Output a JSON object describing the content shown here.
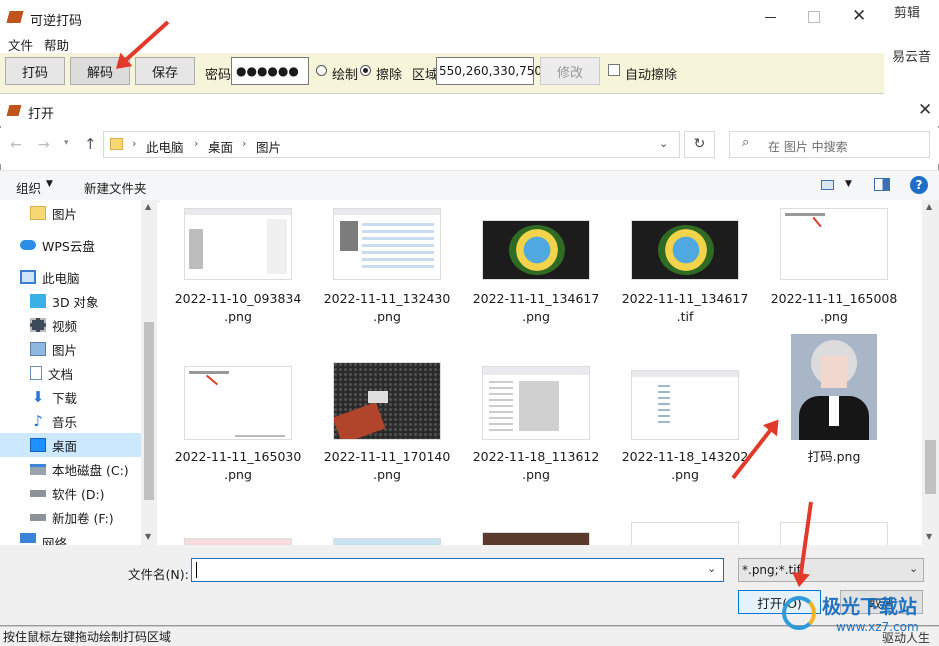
{
  "bg_app": {
    "title": "可逆打码",
    "menu": [
      "文件",
      "帮助"
    ],
    "buttons": {
      "mark": "打码",
      "decode": "解码",
      "save": "保存"
    },
    "password_label": "密码",
    "password_value": "●●●●●●",
    "draw_label": "绘制",
    "erase_label": "擦除",
    "region_label": "区域",
    "region_value": "550,260,330,750",
    "modify_label": "修改",
    "auto_erase_label": "自动擦除",
    "right_fragments": [
      "剪辑",
      "易云音",
      "驱动人生"
    ]
  },
  "dialog": {
    "title": "打开",
    "breadcrumb": [
      "此电脑",
      "桌面",
      "图片"
    ],
    "search_placeholder": "在 图片 中搜索",
    "organize_label": "组织",
    "new_folder_label": "新建文件夹",
    "nav_items": [
      {
        "label": "图片",
        "icon": "folder-icon"
      },
      {
        "label": "WPS云盘",
        "icon": "cloud-icon"
      },
      {
        "label": "此电脑",
        "icon": "computer-icon"
      },
      {
        "label": "3D 对象",
        "icon": "cube-icon"
      },
      {
        "label": "视频",
        "icon": "video-icon"
      },
      {
        "label": "图片",
        "icon": "picture-icon"
      },
      {
        "label": "文档",
        "icon": "document-icon"
      },
      {
        "label": "下载",
        "icon": "download-icon"
      },
      {
        "label": "音乐",
        "icon": "music-icon"
      },
      {
        "label": "桌面",
        "icon": "desktop-icon"
      },
      {
        "label": "本地磁盘 (C:)",
        "icon": "drive-icon"
      },
      {
        "label": "软件 (D:)",
        "icon": "drive-icon"
      },
      {
        "label": "新加卷 (F:)",
        "icon": "drive-icon"
      },
      {
        "label": "网络",
        "icon": "network-icon"
      }
    ],
    "files": [
      {
        "line1": "2022-11-10_093834",
        "line2": ".png"
      },
      {
        "line1": "2022-11-11_132430",
        "line2": ".png"
      },
      {
        "line1": "2022-11-11_134617",
        "line2": ".png"
      },
      {
        "line1": "2022-11-11_134617",
        "line2": ".tif"
      },
      {
        "line1": "2022-11-11_165008",
        "line2": ".png"
      },
      {
        "line1": "2022-11-11_165030",
        "line2": ".png"
      },
      {
        "line1": "2022-11-11_170140",
        "line2": ".png"
      },
      {
        "line1": "2022-11-18_113612",
        "line2": ".png"
      },
      {
        "line1": "2022-11-18_143202",
        "line2": ".png"
      },
      {
        "line1": "打码.png",
        "line2": ""
      }
    ],
    "filename_label": "文件名(N):",
    "filename_value": "",
    "filter_value": "*.png;*.tif",
    "open_label": "打开(O)",
    "cancel_label": "取消"
  },
  "status_text": "按住鼠标左键拖动绘制打码区域",
  "watermark": {
    "brand": "极光下载站",
    "url": "www.xz7.com"
  },
  "colors": {
    "toolbar_bg": "#f7f5d9",
    "selected_nav": "#cce8ff",
    "arrow": "#e23a2a"
  }
}
